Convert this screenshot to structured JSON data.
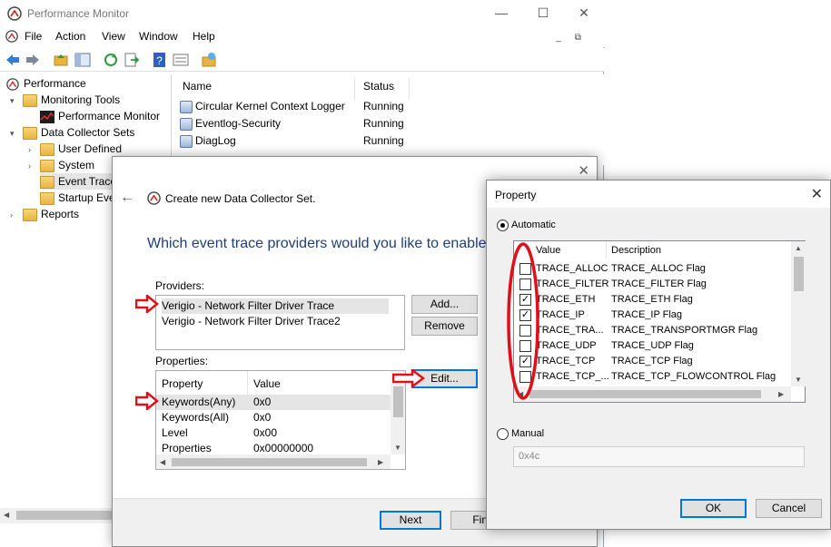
{
  "main_window": {
    "title": "Performance Monitor",
    "menu": [
      "File",
      "Action",
      "View",
      "Window",
      "Help"
    ],
    "tree": [
      {
        "label": "Performance",
        "level": 0
      },
      {
        "label": "Monitoring Tools",
        "level": 1
      },
      {
        "label": "Performance Monitor",
        "level": 2
      },
      {
        "label": "Data Collector Sets",
        "level": 1
      },
      {
        "label": "User Defined",
        "level": 2
      },
      {
        "label": "System",
        "level": 2
      },
      {
        "label": "Event Trace",
        "level": 2
      },
      {
        "label": "Startup Eve",
        "level": 2
      },
      {
        "label": "Reports",
        "level": 1
      }
    ],
    "list": {
      "columns": [
        "Name",
        "Status"
      ],
      "rows": [
        {
          "name": "Circular Kernel Context Logger",
          "status": "Running"
        },
        {
          "name": "Eventlog-Security",
          "status": "Running"
        },
        {
          "name": "DiagLog",
          "status": "Running"
        }
      ]
    }
  },
  "wizard": {
    "title": "Create new Data Collector Set.",
    "question": "Which event trace providers would you like to enable?",
    "providers_label": "Providers:",
    "providers": [
      "Verigio - Network Filter Driver Trace",
      "Verigio - Network Filter Driver Trace2"
    ],
    "add_label": "Add...",
    "remove_label": "Remove",
    "properties_label": "Properties:",
    "properties_columns": [
      "Property",
      "Value"
    ],
    "properties": [
      {
        "k": "Keywords(Any)",
        "v": "0x0"
      },
      {
        "k": "Keywords(All)",
        "v": "0x0"
      },
      {
        "k": "Level",
        "v": "0x00"
      },
      {
        "k": "Properties",
        "v": "0x00000000"
      }
    ],
    "edit_label": "Edit...",
    "next_label": "Next",
    "finish_label": "Fini"
  },
  "property_dialog": {
    "title": "Property",
    "automatic_label": "Automatic",
    "columns": [
      "Value",
      "Description"
    ],
    "rows": [
      {
        "value": "TRACE_ALLOC",
        "desc": "TRACE_ALLOC Flag",
        "checked": false
      },
      {
        "value": "TRACE_FILTER",
        "desc": "TRACE_FILTER Flag",
        "checked": false
      },
      {
        "value": "TRACE_ETH",
        "desc": "TRACE_ETH Flag",
        "checked": true
      },
      {
        "value": "TRACE_IP",
        "desc": "TRACE_IP Flag",
        "checked": true
      },
      {
        "value": "TRACE_TRA...",
        "desc": "TRACE_TRANSPORTMGR Flag",
        "checked": false
      },
      {
        "value": "TRACE_UDP",
        "desc": "TRACE_UDP Flag",
        "checked": false
      },
      {
        "value": "TRACE_TCP",
        "desc": "TRACE_TCP Flag",
        "checked": true
      },
      {
        "value": "TRACE_TCP_...",
        "desc": "TRACE_TCP_FLOWCONTROL Flag",
        "checked": false
      }
    ],
    "manual_label": "Manual",
    "manual_value": "0x4c",
    "ok_label": "OK",
    "cancel_label": "Cancel"
  },
  "colors": {
    "annotation_red": "#e0101a",
    "question_blue": "#1e3f7a",
    "focus_blue": "#0078d7"
  }
}
